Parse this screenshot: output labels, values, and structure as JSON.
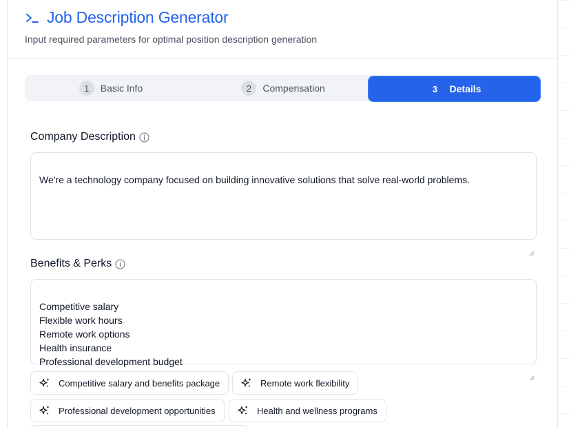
{
  "header": {
    "title": "Job Description Generator",
    "subtitle": "Input required parameters for optimal position description generation",
    "icon": "terminal-prompt-icon"
  },
  "tabs": [
    {
      "number": "1",
      "label": "Basic Info",
      "active": false
    },
    {
      "number": "2",
      "label": "Compensation",
      "active": false
    },
    {
      "number": "3",
      "label": "Details",
      "active": true
    }
  ],
  "company_description": {
    "label": "Company Description",
    "value": "We're a technology company focused on building innovative solutions that solve real-world problems."
  },
  "benefits": {
    "label": "Benefits & Perks",
    "value": "Competitive salary\nFlexible work hours\nRemote work options\nHealth insurance\nProfessional development budget",
    "suggestions": [
      "Competitive salary and benefits package",
      "Remote work flexibility",
      "Professional development opportunities",
      "Health and wellness programs"
    ]
  },
  "colors": {
    "accent": "#2563eb",
    "border": "#e5e7eb",
    "muted_text": "#4b5563"
  }
}
